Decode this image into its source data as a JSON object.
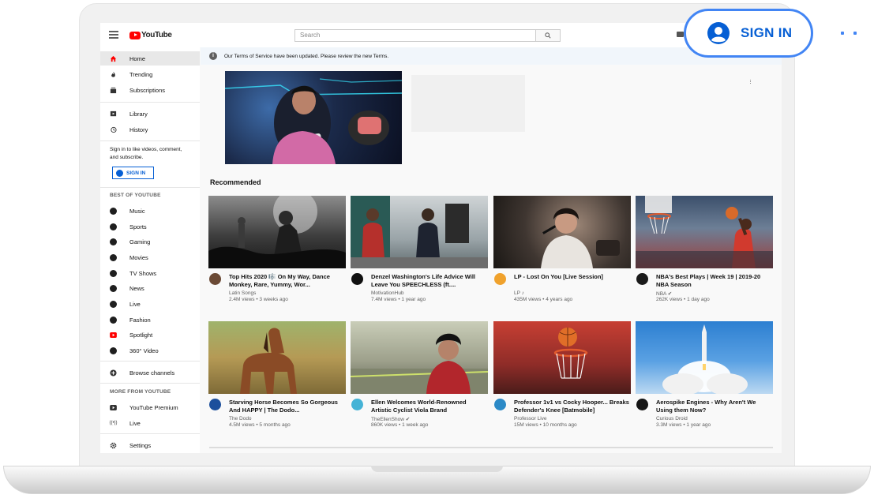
{
  "header": {
    "logo_text": "YouTube",
    "search_placeholder": "Search",
    "search_icon": "search-icon"
  },
  "sidebar": {
    "main_items": [
      {
        "label": "Home",
        "icon": "home-icon",
        "active": true
      },
      {
        "label": "Trending",
        "icon": "flame-icon"
      },
      {
        "label": "Subscriptions",
        "icon": "subscriptions-icon"
      }
    ],
    "library_items": [
      {
        "label": "Library",
        "icon": "library-icon"
      },
      {
        "label": "History",
        "icon": "history-icon"
      }
    ],
    "signin_prompt": "Sign in to like videos, comment, and subscribe.",
    "signin_button": "SIGN IN",
    "best_title": "BEST OF YOUTUBE",
    "best_items": [
      {
        "label": "Music",
        "icon": "music-icon"
      },
      {
        "label": "Sports",
        "icon": "sports-icon"
      },
      {
        "label": "Gaming",
        "icon": "gaming-icon"
      },
      {
        "label": "Movies",
        "icon": "movies-icon"
      },
      {
        "label": "TV Shows",
        "icon": "tv-icon"
      },
      {
        "label": "News",
        "icon": "news-icon"
      },
      {
        "label": "Live",
        "icon": "live-icon"
      },
      {
        "label": "Fashion",
        "icon": "fashion-icon"
      },
      {
        "label": "Spotlight",
        "icon": "spotlight-icon"
      },
      {
        "label": "360° Video",
        "icon": "360-video-icon"
      }
    ],
    "browse_channels": "Browse channels",
    "more_title": "MORE FROM YOUTUBE",
    "more_items": [
      {
        "label": "YouTube Premium",
        "icon": "youtube-premium-icon"
      },
      {
        "label": "Live",
        "icon": "live-broadcast-icon"
      }
    ],
    "settings": "Settings"
  },
  "notice": {
    "text": "Our Terms of Service have been updated. Please review the new Terms."
  },
  "main": {
    "recommended_title": "Recommended",
    "videos": [
      {
        "title": "Top Hits 2020 🎼 On My Way, Dance Monkey, Rare, Yummy, Wor...",
        "channel": "Latin Songs",
        "meta": "2.4M views • 3 weeks ago"
      },
      {
        "title": "Denzel Washington's Life Advice Will Leave You SPEECHLESS (ft....",
        "channel": "MotivationHub",
        "meta": "7.4M views • 1 year ago"
      },
      {
        "title": "LP - Lost On You [Live Session]",
        "channel": "LP ♪",
        "meta": "435M views • 4 years ago"
      },
      {
        "title": "NBA's Best Plays | Week 19 | 2019-20 NBA Season",
        "channel": "NBA ✔",
        "meta": "262K views • 1 day ago"
      },
      {
        "title": "Starving Horse Becomes So Gorgeous And HAPPY | The Dodo...",
        "channel": "The Dodo",
        "meta": "4.5M views • 5 months ago"
      },
      {
        "title": "Ellen Welcomes World-Renowned Artistic Cyclist Viola Brand",
        "channel": "TheEllenShow ✔",
        "meta": "860K views • 1 week ago"
      },
      {
        "title": "Professor 1v1 vs Cocky Hooper... Breaks Defender's Knee [Batmobile]",
        "channel": "Professor Live",
        "meta": "15M views • 10 months ago"
      },
      {
        "title": "Aerospike Engines - Why Aren't We Using them Now?",
        "channel": "Curious Droid",
        "meta": "3.3M views • 1 year ago"
      }
    ]
  },
  "overlay": {
    "signin_label": "SIGN IN"
  },
  "colors": {
    "brand_red": "#ff0000",
    "link_blue": "#065fd4",
    "overlay_blue": "#4285f4"
  }
}
